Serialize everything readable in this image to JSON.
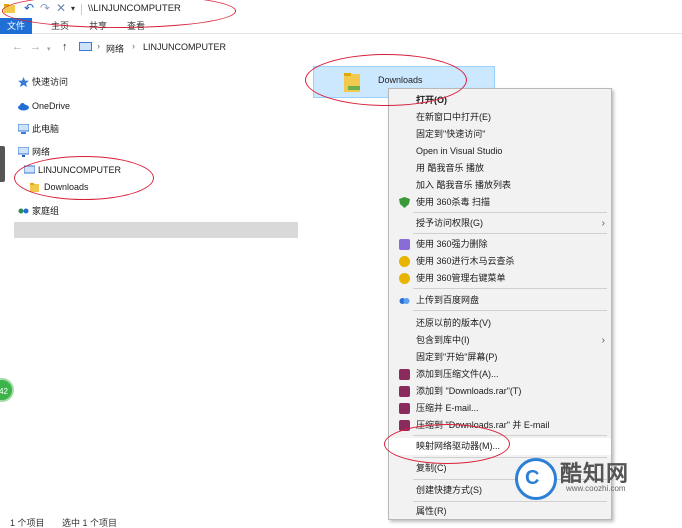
{
  "titlebar": {
    "path": "\\\\LINJUNCOMPUTER",
    "quick_access": [
      "undo-icon",
      "redo-icon",
      "delete-icon",
      "customize-dropdown-icon"
    ]
  },
  "ribbon": {
    "tabs": [
      {
        "label": "文件",
        "active": true
      },
      {
        "label": "主页",
        "active": false
      },
      {
        "label": "共享",
        "active": false
      },
      {
        "label": "查看",
        "active": false
      }
    ]
  },
  "address": {
    "segments": [
      "网络",
      "LINJUNCOMPUTER"
    ]
  },
  "navpane": {
    "items": [
      {
        "label": "快速访问",
        "icon": "star-icon"
      },
      {
        "label": "OneDrive",
        "icon": "cloud-icon"
      },
      {
        "label": "此电脑",
        "icon": "computer-icon"
      },
      {
        "label": "网络",
        "icon": "network-icon"
      },
      {
        "label": "LINJUNCOMPUTER",
        "icon": "computer-icon"
      },
      {
        "label": "Downloads",
        "icon": "folder-icon"
      },
      {
        "label": "家庭组",
        "icon": "homegroup-icon"
      }
    ],
    "side_badge": "42"
  },
  "content": {
    "folder_name": "Downloads"
  },
  "context_menu": {
    "items": [
      {
        "label": "打开(O)",
        "bold": true
      },
      {
        "label": "在新窗口中打开(E)"
      },
      {
        "label": "固定到\"快速访问\""
      },
      {
        "label": "Open in Visual Studio"
      },
      {
        "label": "用 酷我音乐 播放"
      },
      {
        "label": "加入 酷我音乐 播放列表"
      },
      {
        "label": "使用 360杀毒 扫描"
      },
      {
        "label": "授予访问权限(G)"
      },
      {
        "label": "使用 360强力删除"
      },
      {
        "label": "使用 360进行木马云查杀"
      },
      {
        "label": "使用 360管理右键菜单"
      },
      {
        "label": "上传到百度网盘"
      },
      {
        "label": "还原以前的版本(V)"
      },
      {
        "label": "包含到库中(I)"
      },
      {
        "label": "固定到\"开始\"屏幕(P)"
      },
      {
        "label": "添加到压缩文件(A)..."
      },
      {
        "label": "添加到 \"Downloads.rar\"(T)"
      },
      {
        "label": "压缩并 E-mail..."
      },
      {
        "label": "压缩到 \"Downloads.rar\" 并 E-mail"
      },
      {
        "label": "映射网络驱动器(M)..."
      },
      {
        "label": "复制(C)"
      },
      {
        "label": "创建快捷方式(S)"
      },
      {
        "label": "属性(R)"
      }
    ],
    "colors": {
      "shield": "#3a9a3a",
      "rar": "#8b2a5c",
      "baidu": "#2e6fd6",
      "360": "#e8b400"
    }
  },
  "status": {
    "item_count": "1 个项目",
    "selected": "选中 1 个项目"
  },
  "watermark": {
    "name": "酷知网",
    "url": "www.coozhi.com"
  },
  "colors": {
    "accent": "#1f6fd6",
    "selection": "#cce8ff",
    "annotation": "#d9203a"
  }
}
